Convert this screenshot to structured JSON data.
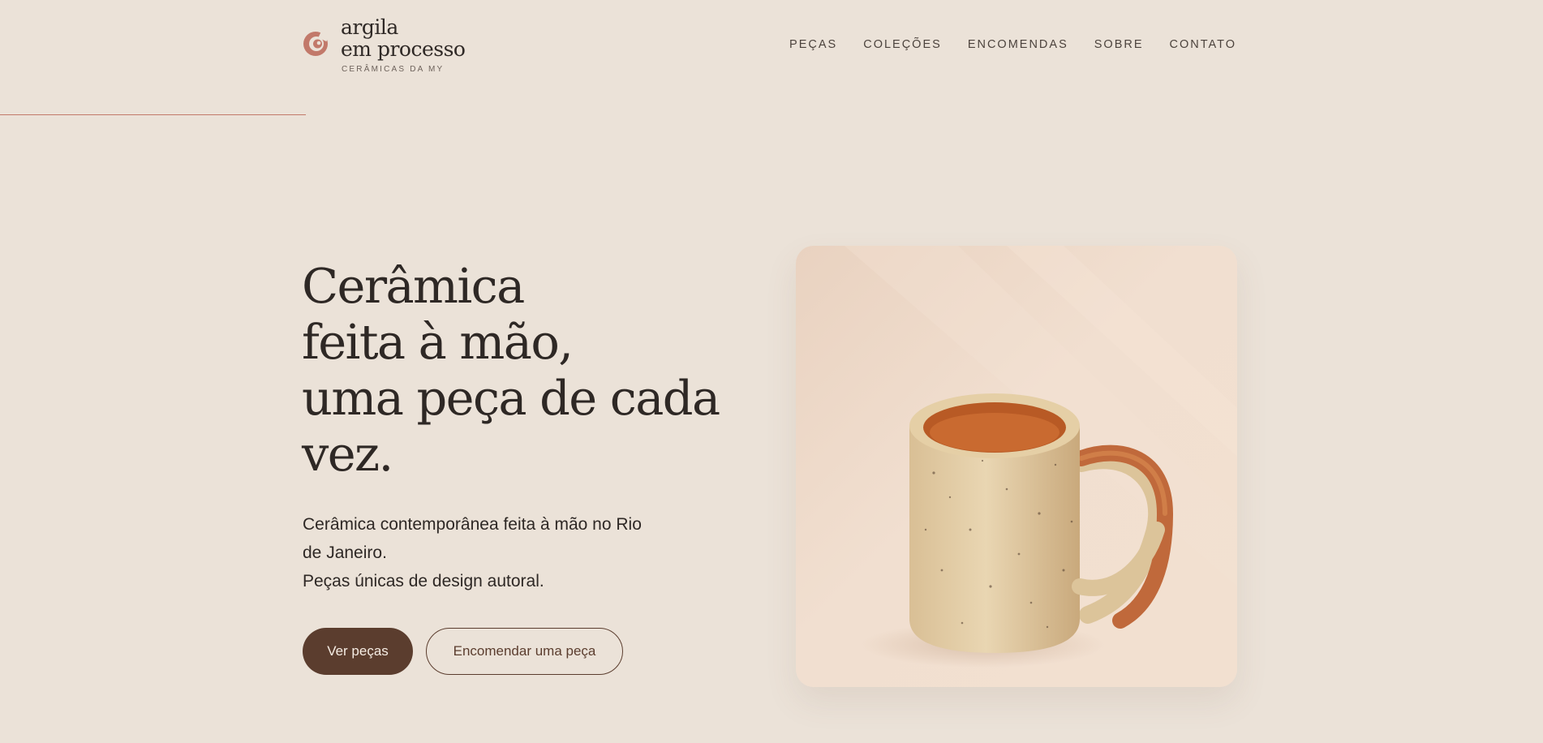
{
  "brand": {
    "line1": "argila",
    "line2": "em processo",
    "tagline": "CERÂMICAS DA MY",
    "mark_icon": "spiral-logo-icon",
    "accent_color": "#c2796a"
  },
  "nav": {
    "items": [
      {
        "label": "PEÇAS"
      },
      {
        "label": "COLEÇÕES"
      },
      {
        "label": "ENCOMENDAS"
      },
      {
        "label": "SOBRE"
      },
      {
        "label": "CONTATO"
      }
    ]
  },
  "hero": {
    "title_lines": [
      "Cerâmica",
      "feita à mão,",
      "uma peça de cada",
      "vez."
    ],
    "description_lines": [
      "Cerâmica contemporânea feita à mão no Rio",
      "de Janeiro.",
      "Peças únicas de design autoral."
    ],
    "primary_button": "Ver peças",
    "secondary_button": "Encomendar uma peça",
    "primary_color": "#5b3d2e"
  }
}
